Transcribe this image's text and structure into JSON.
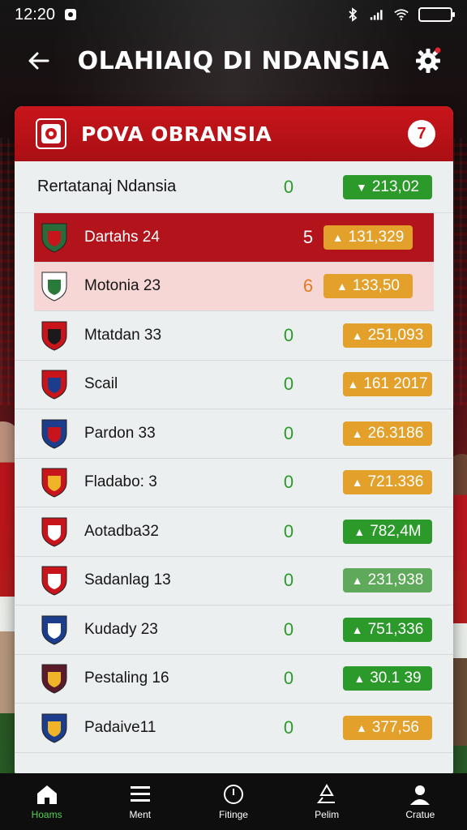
{
  "status_bar": {
    "time": "12:20",
    "colors": {
      "battery": "#4ecb40"
    }
  },
  "app_bar": {
    "title": "OLAHIAIQ DI NDANSIA"
  },
  "card": {
    "title": "POVA OBRANSIA",
    "badge": "7",
    "table_title": "Rertatanaj Ndansia",
    "table_title_score": "0",
    "table_title_pill": "213,02",
    "rows": [
      {
        "team": "Dartahs 24",
        "score": "5",
        "value": "131,329",
        "pill_color": "#e3a02a",
        "score_color": "#ffffff"
      },
      {
        "team": "Motonia 23",
        "score": "6",
        "value": "133,50",
        "pill_color": "#e3a02a",
        "score_color": "#e87a22"
      },
      {
        "team": "Mtatdan 33",
        "score": "0",
        "value": "251,093",
        "pill_color": "#e3a02a",
        "score_color": "#2b9a2b"
      },
      {
        "team": "Scail",
        "score": "0",
        "value": "161 2017",
        "pill_color": "#e3a02a",
        "score_color": "#2b9a2b"
      },
      {
        "team": "Pardon 33",
        "score": "0",
        "value": "26.3186",
        "pill_color": "#e3a02a",
        "score_color": "#2b9a2b"
      },
      {
        "team": "Fladabo: 3",
        "score": "0",
        "value": "721.336",
        "pill_color": "#e3a02a",
        "score_color": "#2b9a2b"
      },
      {
        "team": "Aotadba32",
        "score": "0",
        "value": "782,4M",
        "pill_color": "#2b9a2b",
        "score_color": "#2b9a2b"
      },
      {
        "team": "Sadanlag 13",
        "score": "0",
        "value": "231,938",
        "pill_color": "#5eaa5a",
        "score_color": "#2b9a2b"
      },
      {
        "team": "Kudady 23",
        "score": "0",
        "value": "751,336",
        "pill_color": "#2b9a2b",
        "score_color": "#2b9a2b"
      },
      {
        "team": "Pestaling 16",
        "score": "0",
        "value": "30.1 39",
        "pill_color": "#2b9a2b",
        "score_color": "#2b9a2b"
      },
      {
        "team": "Padaive11",
        "score": "0",
        "value": "377,56",
        "pill_color": "#e3a02a",
        "score_color": "#2b9a2b"
      }
    ]
  },
  "bottom_nav": [
    {
      "label": "Hoams",
      "icon": "home-icon"
    },
    {
      "label": "Ment",
      "icon": "menu-icon"
    },
    {
      "label": "Fitinge",
      "icon": "compass-icon"
    },
    {
      "label": "Pelim",
      "icon": "recycle-icon"
    },
    {
      "label": "Cratue",
      "icon": "profile-icon"
    }
  ],
  "colors": {
    "accent": "#c8151b",
    "green": "#2b9a2b",
    "orange": "#e3a02a",
    "active_nav": "#4fd24f"
  }
}
